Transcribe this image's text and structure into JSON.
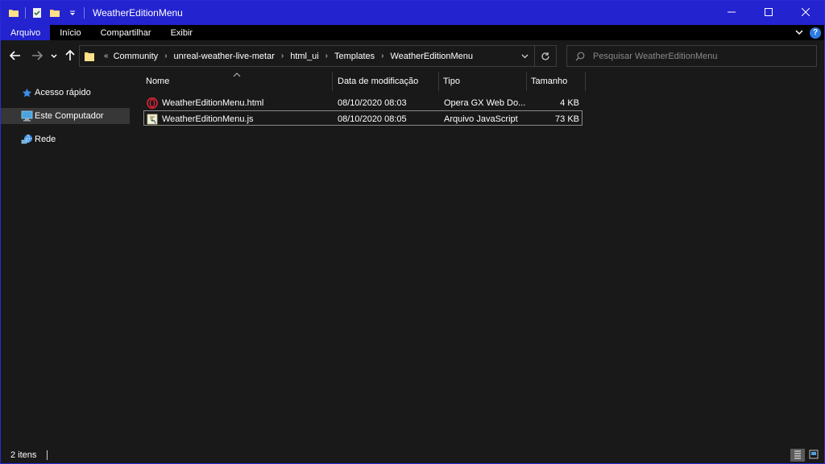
{
  "window": {
    "title": "WeatherEditionMenu",
    "accent": "#2323cf",
    "controls": {
      "minimize_icon": "minimize-icon",
      "maximize_icon": "maximize-icon",
      "close_icon": "close-icon"
    }
  },
  "quick_access": {
    "icons": [
      "folder-icon",
      "properties-check-icon",
      "new-folder-icon",
      "customize-dropdown-icon"
    ]
  },
  "ribbon": {
    "tabs": [
      {
        "label": "Arquivo",
        "active": true
      },
      {
        "label": "Início",
        "active": false
      },
      {
        "label": "Compartilhar",
        "active": false
      },
      {
        "label": "Exibir",
        "active": false
      }
    ],
    "help_label": "?"
  },
  "nav": {
    "back_icon": "back-arrow-icon",
    "forward_icon": "forward-arrow-icon",
    "recent_icon": "chevron-down-icon",
    "up_icon": "up-arrow-icon"
  },
  "address": {
    "overflow": "«",
    "crumbs": [
      "Community",
      "unreal-weather-live-metar",
      "html_ui",
      "Templates",
      "WeatherEditionMenu"
    ],
    "separator": "›"
  },
  "search": {
    "placeholder": "Pesquisar WeatherEditionMenu"
  },
  "sidebar": {
    "items": [
      {
        "label": "Acesso rápido",
        "icon": "star-icon",
        "selected": false
      },
      {
        "label": "Este Computador",
        "icon": "computer-icon",
        "selected": true
      },
      {
        "label": "Rede",
        "icon": "network-icon",
        "selected": false
      }
    ]
  },
  "table": {
    "columns": [
      "Nome",
      "Data de modificação",
      "Tipo",
      "Tamanho"
    ],
    "rows": [
      {
        "name": "WeatherEditionMenu.html",
        "modified": "08/10/2020 08:03",
        "type": "Opera GX Web Do...",
        "size": "4 KB",
        "icon": "opera-gx-icon"
      },
      {
        "name": "WeatherEditionMenu.js",
        "modified": "08/10/2020 08:05",
        "type": "Arquivo JavaScript",
        "size": "73 KB",
        "icon": "javascript-file-icon"
      }
    ]
  },
  "status": {
    "item_count": "2 itens"
  }
}
